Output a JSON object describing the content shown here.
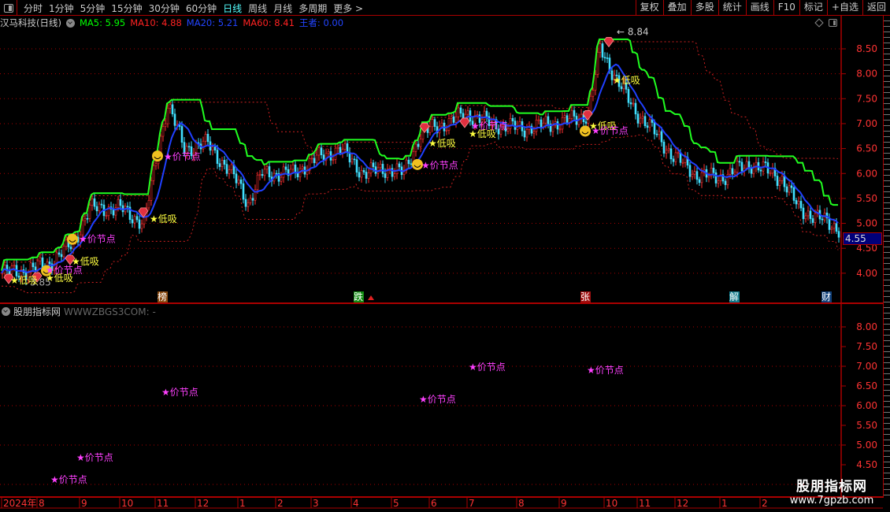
{
  "toolbar": {
    "tabs": [
      {
        "label": "分时"
      },
      {
        "label": "1分钟"
      },
      {
        "label": "5分钟"
      },
      {
        "label": "15分钟"
      },
      {
        "label": "30分钟"
      },
      {
        "label": "60分钟"
      },
      {
        "label": "日线",
        "active": true
      },
      {
        "label": "周线"
      },
      {
        "label": "月线"
      },
      {
        "label": "多周期"
      },
      {
        "label": "更多 >"
      }
    ],
    "right_buttons": [
      "复权",
      "叠加",
      "多股",
      "统计",
      "画线",
      "F10",
      "标记",
      "+自选",
      "返回"
    ]
  },
  "info": {
    "title": "汉马科技(日线)",
    "ma5": "MA5: 5.95",
    "ma10": "MA10: 4.88",
    "ma20": "MA20: 5.21",
    "ma60": "MA60: 8.41",
    "wangzhe": "王者: 0.00",
    "colors": {
      "ma5": "#00ff00",
      "ma10": "#ff2020",
      "ma20": "#2040ff",
      "ma60": "#ff2020",
      "wangzhe": "#2040ff"
    }
  },
  "main_axis": {
    "ticks": [
      "8.50",
      "8.00",
      "7.50",
      "7.00",
      "6.50",
      "6.00",
      "5.50",
      "5.00",
      "4.50",
      "4.00"
    ],
    "current_price": "4.55",
    "high_label": "8.84",
    "low_label": "3.85"
  },
  "price_path": [
    [
      0,
      4.0
    ],
    [
      10,
      4.05
    ],
    [
      20,
      4.2
    ],
    [
      30,
      4.6
    ],
    [
      37,
      5.3
    ],
    [
      50,
      5.3
    ],
    [
      60,
      5.0
    ],
    [
      66,
      6.5
    ],
    [
      70,
      7.4
    ],
    [
      77,
      6.5
    ],
    [
      87,
      6.6
    ],
    [
      100,
      5.8
    ],
    [
      104,
      5.4
    ],
    [
      110,
      6.0
    ],
    [
      123,
      6.0
    ],
    [
      133,
      6.3
    ],
    [
      143,
      6.5
    ],
    [
      153,
      6.0
    ],
    [
      163,
      6.1
    ],
    [
      170,
      6.0
    ],
    [
      177,
      6.8
    ],
    [
      187,
      7.0
    ],
    [
      197,
      7.2
    ],
    [
      207,
      7.0
    ],
    [
      220,
      6.9
    ],
    [
      233,
      7.0
    ],
    [
      243,
      7.1
    ],
    [
      248,
      7.2
    ],
    [
      253,
      8.5
    ],
    [
      260,
      7.9
    ],
    [
      267,
      7.3
    ],
    [
      273,
      7.0
    ],
    [
      283,
      6.4
    ],
    [
      293,
      6.0
    ],
    [
      303,
      5.9
    ],
    [
      317,
      6.2
    ],
    [
      330,
      5.9
    ],
    [
      337,
      5.3
    ],
    [
      350,
      5.0
    ],
    [
      354,
      4.9
    ]
  ],
  "signals": {
    "dixi_label": "低吸",
    "jiajiedian_label": "价节点",
    "dixi": [
      [
        5,
        3.87
      ],
      [
        20,
        3.92
      ],
      [
        31,
        4.25
      ],
      [
        64,
        5.1
      ],
      [
        182,
        6.62
      ],
      [
        199,
        6.81
      ],
      [
        250,
        6.97
      ],
      [
        260,
        7.88
      ]
    ],
    "jiajiedian": [
      [
        20,
        4.08
      ],
      [
        34,
        4.7
      ],
      [
        70,
        6.35
      ],
      [
        179,
        6.18
      ],
      [
        200,
        6.97
      ],
      [
        251,
        6.87
      ]
    ],
    "smiley": [
      [
        19,
        4.05
      ],
      [
        30,
        4.68
      ],
      [
        66,
        6.35
      ],
      [
        176,
        6.18
      ],
      [
        247,
        6.85
      ]
    ],
    "gem": [
      [
        3,
        3.87
      ],
      [
        15,
        3.9
      ],
      [
        29,
        4.25
      ],
      [
        60,
        5.2
      ],
      [
        179,
        6.9
      ],
      [
        196,
        7.0
      ],
      [
        248,
        7.15
      ],
      [
        257,
        8.62
      ]
    ]
  },
  "events": [
    {
      "label": "榜",
      "color": "#8a4a10",
      "day": 68
    },
    {
      "label": "跌",
      "color": "#108a10",
      "day": 151,
      "arrow": true
    },
    {
      "label": "张",
      "color": "#a01010",
      "day": 247
    },
    {
      "label": "解",
      "color": "#107a8a",
      "day": 310
    },
    {
      "label": "财",
      "color": "#10407a",
      "day": 349
    }
  ],
  "panel2": {
    "title": "股朋指标网",
    "subtitle": "WWWZBGS3COM: -",
    "ticks": [
      "8.00",
      "7.50",
      "7.00",
      "6.50",
      "6.00",
      "5.50",
      "5.00",
      "4.50"
    ],
    "stars": [
      [
        22,
        4.14
      ],
      [
        33,
        4.7
      ],
      [
        69,
        6.36
      ],
      [
        178,
        6.18
      ],
      [
        199,
        7.0
      ],
      [
        249,
        6.92
      ]
    ]
  },
  "time_axis": [
    {
      "label": "2024年",
      "day": 0
    },
    {
      "label": "8",
      "day": 15
    },
    {
      "label": "9",
      "day": 33
    },
    {
      "label": "10",
      "day": 50
    },
    {
      "label": "11",
      "day": 65
    },
    {
      "label": "12",
      "day": 82
    },
    {
      "label": "1",
      "day": 100
    },
    {
      "label": "2",
      "day": 116
    },
    {
      "label": "3",
      "day": 131
    },
    {
      "label": "4",
      "day": 148
    },
    {
      "label": "5",
      "day": 165
    },
    {
      "label": "6",
      "day": 181
    },
    {
      "label": "7",
      "day": 197
    },
    {
      "label": "8",
      "day": 218
    },
    {
      "label": "9",
      "day": 236
    },
    {
      "label": "10",
      "day": 255
    },
    {
      "label": "11",
      "day": 269
    },
    {
      "label": "12",
      "day": 285
    },
    {
      "label": "1",
      "day": 304
    },
    {
      "label": "2",
      "day": 321
    }
  ],
  "watermark": {
    "title": "股朋指标网",
    "url": "www.7gpzb.com"
  }
}
